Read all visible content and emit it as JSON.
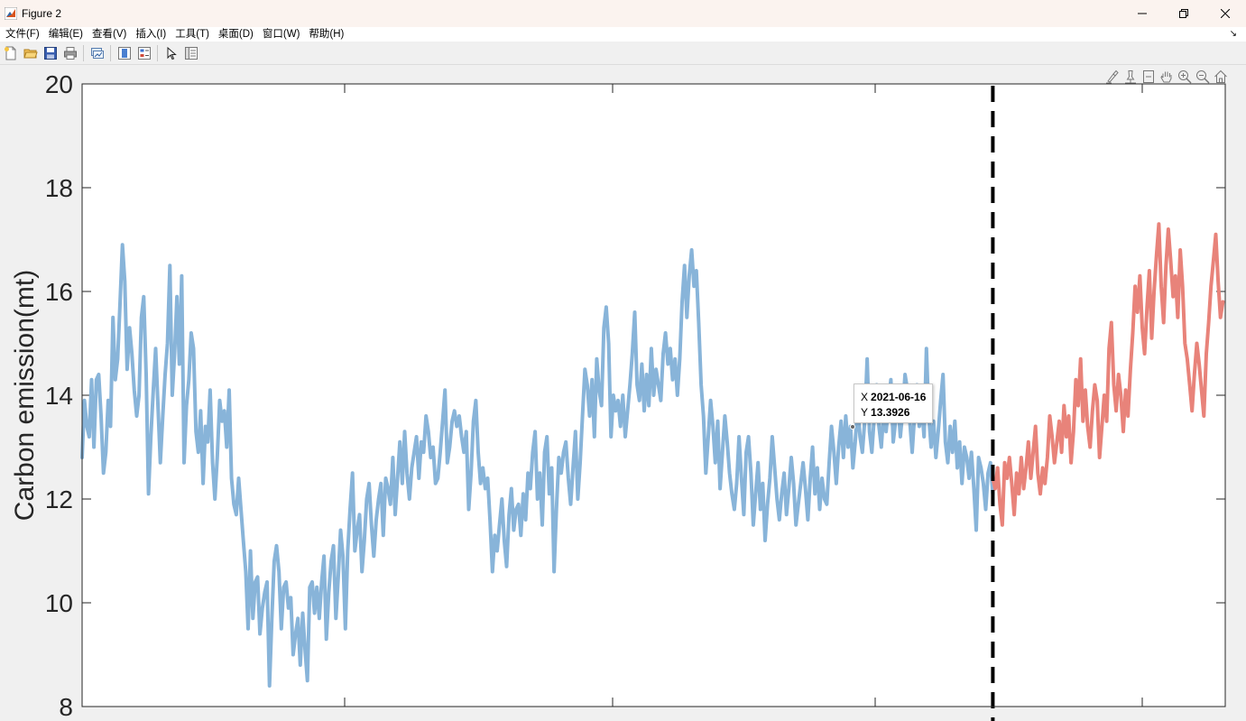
{
  "window": {
    "title": "Figure 2"
  },
  "menu": {
    "items": [
      "文件(F)",
      "编辑(E)",
      "查看(V)",
      "插入(I)",
      "工具(T)",
      "桌面(D)",
      "窗口(W)",
      "帮助(H)"
    ],
    "expand_glyph": "↘"
  },
  "toolbar": {
    "icons": [
      "new-figure-icon",
      "open-file-icon",
      "save-icon",
      "print-icon",
      "link-plot-icon",
      "colorbar-icon",
      "legend-icon",
      "edit-plot-arrow-icon",
      "property-inspector-icon"
    ]
  },
  "axes_toolbar": {
    "icons": [
      "brush-icon",
      "data-tips-icon",
      "restore-view-icon",
      "pan-icon",
      "zoom-in-icon",
      "zoom-out-icon",
      "home-icon"
    ]
  },
  "datatip": {
    "x_key": "X",
    "x_value": "2021-06-16",
    "y_key": "Y",
    "y_value": "13.3926"
  },
  "chart_data": {
    "type": "line",
    "ylabel": "Carbon emission(mt)",
    "xlabel": "",
    "ylim": [
      8,
      20
    ],
    "y_ticks": [
      "8",
      "10",
      "12",
      "14",
      "16",
      "18",
      "20"
    ],
    "x_tick_labels_visible": false,
    "grid": false,
    "colors": {
      "historical": "#88b4d9",
      "forecast": "#e8837a",
      "divider": "#000000"
    },
    "series": [
      {
        "x_range": [
          "2019-01-01",
          "2022-02-25"
        ],
        "values": [
          12.8,
          13.9,
          13.4,
          13.2,
          14.3,
          13.0,
          14.3,
          14.4,
          13.6,
          12.5,
          12.9,
          13.9,
          13.4,
          15.5,
          14.3,
          14.7,
          15.8,
          16.9,
          16.2,
          14.5,
          15.3,
          14.8,
          14.1,
          13.6,
          14.0,
          15.5,
          15.9,
          14.4,
          12.1,
          13.2,
          14.1,
          14.9,
          13.8,
          12.7,
          13.6,
          14.4,
          15.0,
          16.5,
          14.0,
          14.8,
          15.9,
          14.6,
          16.3,
          12.7,
          13.8,
          14.3,
          15.2,
          14.9,
          13.3,
          12.9,
          13.7,
          12.3,
          13.4,
          13.1,
          14.1,
          12.7,
          12.0,
          12.8,
          13.9,
          13.5,
          13.7,
          13.0,
          14.1,
          12.4,
          11.9,
          11.7,
          12.4,
          11.8,
          11.2,
          10.6,
          9.5,
          11.0,
          9.7,
          10.4,
          10.5,
          9.4,
          9.9,
          10.2,
          10.4,
          8.4,
          9.7,
          10.8,
          11.1,
          10.6,
          9.5,
          10.3,
          10.4,
          9.9,
          10.1,
          9.0,
          9.4,
          9.7,
          8.8,
          9.8,
          9.1,
          8.5,
          10.3,
          10.4,
          9.8,
          10.3,
          9.7,
          10.4,
          10.9,
          9.3,
          10.2,
          10.8,
          11.1,
          9.7,
          10.5,
          11.4,
          10.9,
          9.5,
          11.0,
          11.8,
          12.5,
          11.0,
          11.4,
          11.7,
          10.6,
          11.2,
          12.0,
          12.3,
          11.5,
          10.9,
          11.6,
          12.0,
          12.3,
          11.3,
          12.4,
          12.2,
          11.9,
          12.8,
          11.7,
          12.4,
          13.1,
          12.3,
          13.3,
          12.5,
          12.0,
          12.6,
          12.9,
          13.2,
          12.4,
          13.1,
          12.9,
          13.6,
          13.3,
          12.8,
          13.0,
          12.3,
          12.4,
          12.9,
          13.5,
          14.1,
          12.7,
          13.0,
          13.5,
          13.7,
          13.4,
          13.6,
          13.2,
          12.9,
          13.3,
          11.8,
          12.5,
          13.5,
          13.9,
          12.9,
          12.3,
          12.6,
          12.2,
          12.4,
          11.6,
          10.6,
          11.3,
          11.0,
          11.5,
          12.0,
          11.2,
          10.7,
          11.7,
          12.2,
          11.4,
          11.8,
          11.9,
          11.3,
          12.1,
          11.6,
          12.5,
          12.2,
          12.9,
          13.3,
          12.0,
          12.5,
          11.5,
          12.9,
          13.2,
          12.1,
          12.6,
          10.6,
          11.8,
          12.8,
          12.5,
          12.9,
          13.1,
          12.4,
          11.9,
          12.6,
          13.3,
          12.0,
          12.7,
          13.6,
          14.5,
          14.2,
          13.6,
          14.3,
          13.2,
          14.7,
          14.1,
          13.8,
          15.3,
          15.7,
          15.0,
          13.2,
          14.0,
          13.7,
          13.9,
          13.4,
          14.0,
          13.2,
          13.7,
          14.2,
          14.8,
          15.6,
          14.2,
          13.9,
          14.6,
          13.7,
          14.4,
          13.8,
          14.9,
          14.0,
          14.5,
          14.2,
          13.9,
          14.8,
          15.2,
          14.6,
          14.9,
          14.3,
          14.7,
          14.0,
          14.7,
          15.8,
          16.5,
          15.5,
          16.3,
          16.8,
          16.1,
          16.4,
          15.4,
          14.2,
          13.6,
          12.5,
          13.2,
          13.9,
          13.4,
          12.7,
          13.5,
          12.2,
          12.9,
          13.6,
          13.1,
          12.5,
          12.1,
          11.8,
          12.3,
          13.2,
          12.4,
          11.7,
          12.9,
          13.2,
          12.5,
          11.5,
          12.1,
          12.7,
          11.8,
          12.3,
          11.2,
          11.9,
          12.4,
          13.2,
          12.6,
          12.0,
          11.6,
          12.1,
          12.5,
          11.7,
          12.2,
          12.8,
          12.3,
          11.5,
          11.9,
          12.3,
          12.7,
          12.2,
          11.6,
          12.4,
          13.0,
          12.1,
          12.6,
          11.8,
          12.4,
          12.0,
          11.9,
          12.7,
          13.4,
          12.9,
          12.3,
          13.0,
          13.5,
          12.8,
          13.6,
          13.0,
          13.4,
          12.6,
          13.1,
          13.8,
          13.2,
          12.9,
          13.5,
          14.7,
          13.3,
          12.9,
          13.6,
          14.2,
          13.4,
          13.0,
          13.7,
          13.3,
          13.8,
          14.3,
          13.1,
          13.5,
          13.9,
          13.2,
          13.7,
          14.4,
          14.1,
          13.5,
          12.9,
          13.6,
          14.2,
          13.4,
          13.8,
          13.2,
          14.9,
          13.6,
          13.0,
          13.5,
          12.8,
          13.3,
          13.9,
          14.4,
          13.1,
          12.7,
          13.4,
          12.9,
          13.5,
          12.6,
          13.1,
          12.3,
          13.0,
          12.8,
          12.4,
          12.9,
          12.2,
          11.4,
          12.8,
          12.6,
          12.3,
          11.8,
          12.5,
          12.7,
          12.1
        ]
      },
      {
        "x_range": [
          "2022-02-25",
          "2022-12-31"
        ],
        "values": [
          12.4,
          12.2,
          12.6,
          11.9,
          11.5,
          12.7,
          12.4,
          12.8,
          12.3,
          11.7,
          12.5,
          12.1,
          12.8,
          12.2,
          12.6,
          13.1,
          12.4,
          12.9,
          13.4,
          12.5,
          12.1,
          12.6,
          12.3,
          12.8,
          13.6,
          13.2,
          12.7,
          13.1,
          13.5,
          12.9,
          13.8,
          13.2,
          13.6,
          12.7,
          13.3,
          14.3,
          13.8,
          14.7,
          13.5,
          14.1,
          13.4,
          13.0,
          13.7,
          14.2,
          13.9,
          12.8,
          13.4,
          14.0,
          13.5,
          14.9,
          15.4,
          14.2,
          13.7,
          14.4,
          14.0,
          13.3,
          14.1,
          13.6,
          14.5,
          15.2,
          16.1,
          15.6,
          16.3,
          15.3,
          14.8,
          15.7,
          16.4,
          15.1,
          16.0,
          16.7,
          17.3,
          16.1,
          15.4,
          16.5,
          17.2,
          16.6,
          15.9,
          16.3,
          15.5,
          16.8,
          16.1,
          15.0,
          14.7,
          14.2,
          13.7,
          14.4,
          15.0,
          14.6,
          14.1,
          13.6,
          14.8,
          15.4,
          16.1,
          16.6,
          17.1,
          16.2,
          15.5,
          15.8
        ]
      }
    ],
    "forecast_start_date": "2022-02-25"
  }
}
